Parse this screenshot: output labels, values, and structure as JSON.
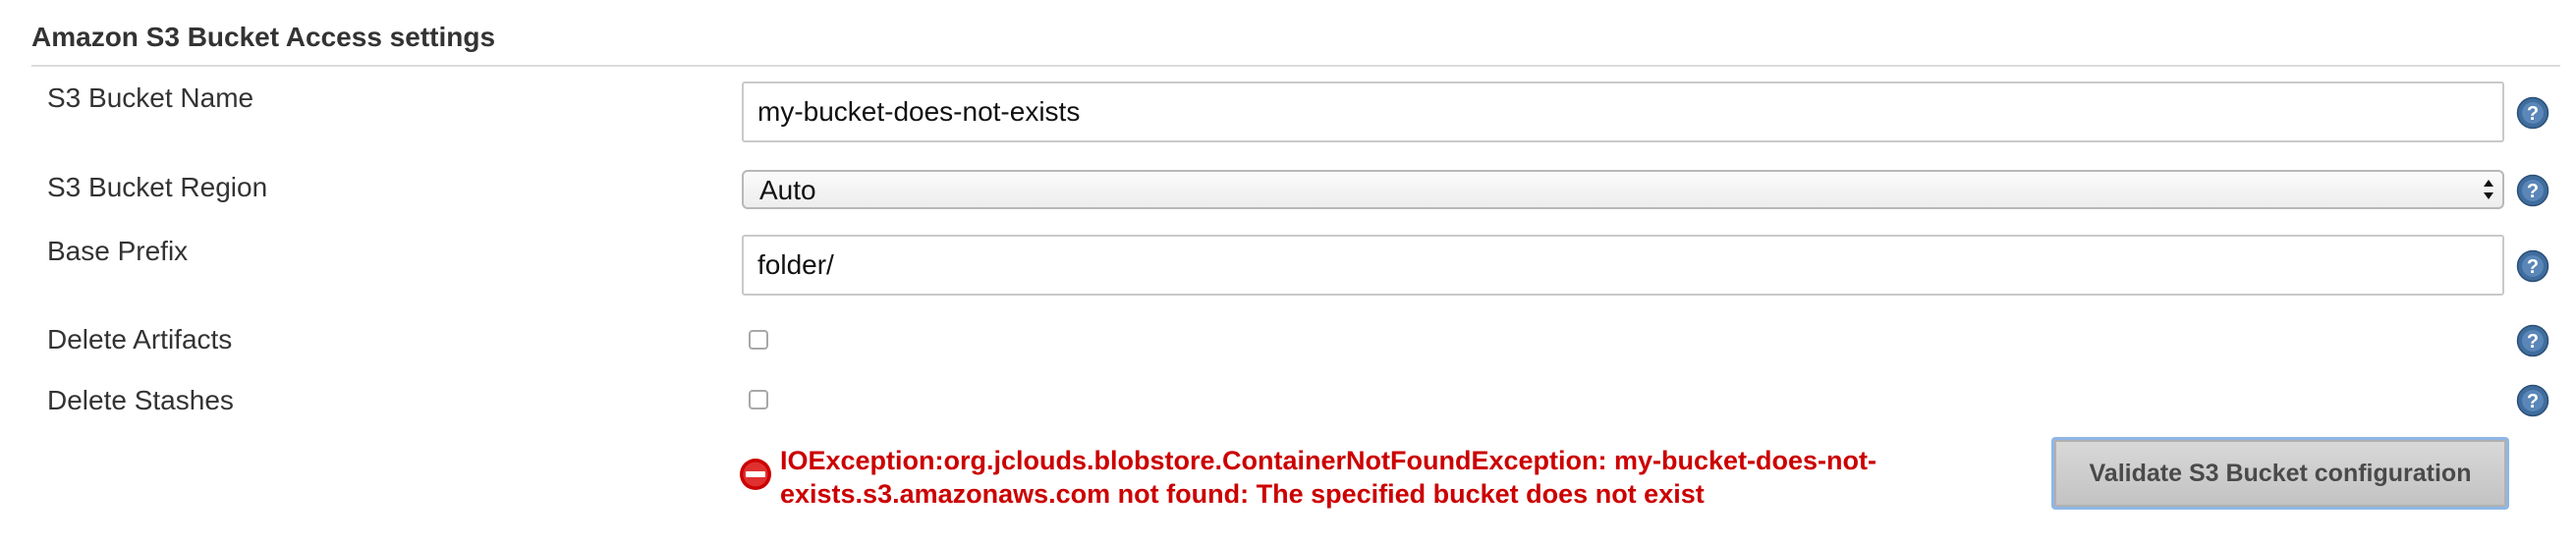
{
  "section": {
    "title": "Amazon S3 Bucket Access settings"
  },
  "fields": {
    "bucket_name": {
      "label": "S3 Bucket Name",
      "value": "my-bucket-does-not-exists"
    },
    "bucket_region": {
      "label": "S3 Bucket Region",
      "selected": "Auto"
    },
    "base_prefix": {
      "label": "Base Prefix",
      "value": "folder/"
    },
    "delete_artifacts": {
      "label": "Delete Artifacts",
      "checked": false
    },
    "delete_stashes": {
      "label": "Delete Stashes",
      "checked": false
    }
  },
  "error": {
    "line1": "IOException:org.jclouds.blobstore.ContainerNotFoundException: my-bucket-does-not-",
    "line2": "exists.s3.amazonaws.com not found: The specified bucket does not exist",
    "color": "#cc0000"
  },
  "validate_button": {
    "label": "Validate S3 Bucket configuration"
  },
  "icons": {
    "help": "help-icon",
    "error": "error-icon",
    "select": "select-arrows-icon"
  },
  "colors": {
    "help_icon": "#3f6d9e",
    "error": "#cc0000",
    "button_focus": "#8fb6e6"
  }
}
